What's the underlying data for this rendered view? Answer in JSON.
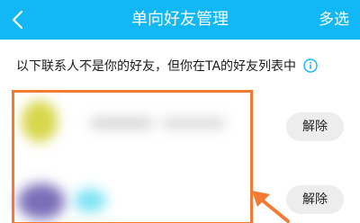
{
  "header": {
    "title": "单向好友管理",
    "multi_select_label": "多选",
    "back_icon": "chevron-left-icon",
    "background_color": "#12b7f5"
  },
  "notice": {
    "text": "以下联系人不是你的好友，但你在TA的好友列表中",
    "icon": "info-icon",
    "icon_color": "#12b7f5"
  },
  "contacts": [
    {
      "remove_label": "解除"
    },
    {
      "remove_label": "解除"
    }
  ],
  "annotation": {
    "highlight_color": "#f27a33"
  }
}
